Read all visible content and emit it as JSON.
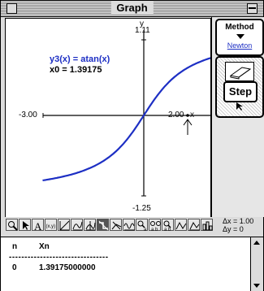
{
  "window": {
    "title": "Graph"
  },
  "graph": {
    "function_label": "y3(x) = atan(x)",
    "x0_label": "x0 = 1.39175",
    "y_axis_name": "y",
    "x_axis_name": "x",
    "ymax": "1.11",
    "ymin": "-1.25",
    "xmin": "-3.00",
    "xmax": "2.00",
    "curve_color": "#1d2fc4",
    "x0_value": 1.39175
  },
  "method": {
    "title": "Method",
    "value": "Newton"
  },
  "step_button": "Step",
  "toolbar": {
    "icons": [
      "magnifier-icon",
      "arrow-icon",
      "text-icon",
      "xy-icon",
      "line-icon",
      "curve-icon",
      "grid-icon",
      "tangent-icon",
      "intersect-icon",
      "wave-icon",
      "zoom-box-icon",
      "multi-zoom-icon",
      "triangle-icon",
      "zigzag-icon",
      "bars-icon"
    ],
    "delta_x": "Δx = 1.00",
    "delta_y": "Δy = 0"
  },
  "output": {
    "col_n": "n",
    "col_xn": "Xn",
    "separator": "--------------------------------",
    "rows": [
      {
        "n": "0",
        "xn": "1.39175000000"
      }
    ]
  }
}
